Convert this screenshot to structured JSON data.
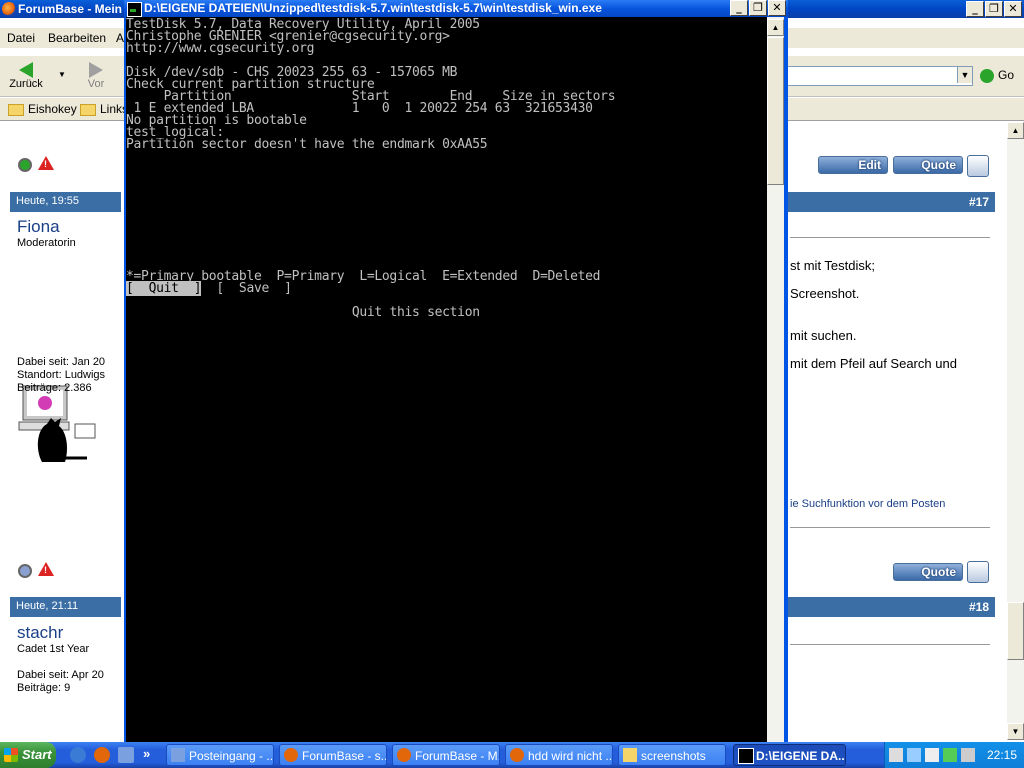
{
  "firefox": {
    "title": "ForumBase - Mein",
    "menu": [
      "Datei",
      "Bearbeiten",
      "A"
    ],
    "back_label": "Zurück",
    "forward_label": "Vor",
    "go_label": "Go",
    "bookmarks": [
      "Eishokey",
      "Links"
    ]
  },
  "forum": {
    "posts": [
      {
        "time": "Heute, 19:55",
        "number": "#17",
        "user": "Fiona",
        "rank": "Moderatorin",
        "joined": "Dabei seit: Jan 20",
        "location": "Standort: Ludwigs",
        "posts": "Beiträge: 2.386",
        "text": [
          "st mit Testdisk;",
          "Screenshot.",
          "mit suchen.",
          "mit dem Pfeil auf Search und"
        ],
        "footer_text": "ie Suchfunktion vor dem Posten"
      },
      {
        "time": "Heute, 21:11",
        "number": "#18",
        "user": "stachr",
        "rank": "Cadet 1st Year",
        "joined": "Dabei seit: Apr 20",
        "posts": "Beiträge: 9"
      }
    ],
    "edit_label": "Edit",
    "quote_label": "Quote"
  },
  "console": {
    "title": "D:\\EIGENE DATEIEN\\Unzipped\\testdisk-5.7.win\\testdisk-5.7\\win\\testdisk_win.exe",
    "lines": [
      "TestDisk 5.7, Data Recovery Utility, April 2005",
      "Christophe GRENIER <grenier@cgsecurity.org>",
      "http://www.cgsecurity.org",
      "",
      "Disk /dev/sdb - CHS 20023 255 63 - 157065 MB",
      "Check current partition structure",
      "     Partition                Start        End    Size in sectors",
      " 1 E extended LBA             1   0  1 20022 254 63  321653430",
      "No partition is bootable",
      "test_logical:",
      "Partition sector doesn't have the endmark 0xAA55",
      "",
      "",
      "",
      "",
      "",
      "",
      "",
      "",
      "",
      "",
      "*=Primary bootable  P=Primary  L=Logical  E=Extended  D=Deleted"
    ],
    "menu_quit": "[  Quit  ]",
    "menu_save": "[  Save  ]",
    "hint": "Quit this section"
  },
  "taskbar": {
    "start": "Start",
    "tasks": [
      "Posteingang - ...",
      "ForumBase - s...",
      "ForumBase - M...",
      "hdd wird nicht ...",
      "screenshots",
      "D:\\EIGENE DA..."
    ],
    "clock": "22:15"
  },
  "colors": {
    "xp_blue": "#0855dd",
    "console_bg": "#000000",
    "console_fg": "#c0c0c0",
    "forum_bar": "#3a6ea5"
  }
}
